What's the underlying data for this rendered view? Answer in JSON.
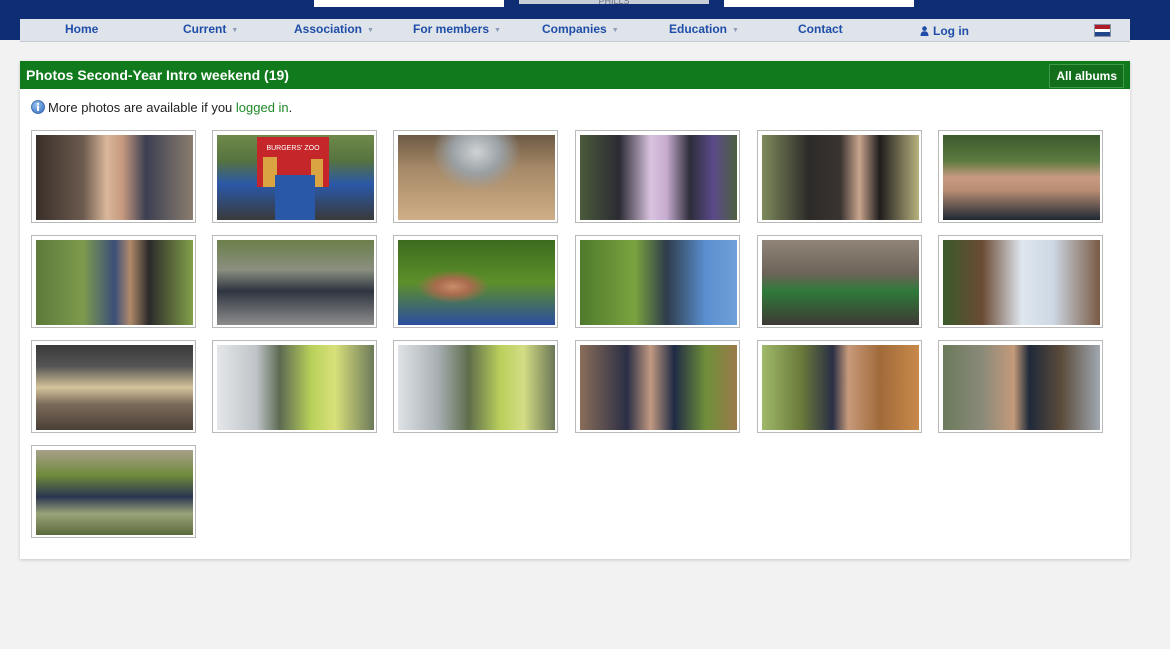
{
  "nav": {
    "items": [
      {
        "label": "Home",
        "caret": ""
      },
      {
        "label": "Current",
        "caret": "▼"
      },
      {
        "label": "Association",
        "caret": "▼"
      },
      {
        "label": "For members",
        "caret": "▼"
      },
      {
        "label": "Companies",
        "caret": "▼"
      },
      {
        "label": "Education",
        "caret": "▼"
      },
      {
        "label": "Contact",
        "caret": ""
      }
    ],
    "login_label": "Log in",
    "flag_icon": "dutch-flag-icon"
  },
  "banner": {
    "partner_text": "PHILLS"
  },
  "album": {
    "title": "Photos Second-Year Intro weekend (19)",
    "all_albums_label": "All albums"
  },
  "notice": {
    "prefix": "More photos are available if you ",
    "link": "logged in",
    "suffix": "."
  },
  "colors": {
    "header_green": "#117a1c",
    "link_blue": "#1f4ea8",
    "link_green": "#1e8a28",
    "top_navy": "#0e2d73"
  },
  "photos": [
    {
      "name": "photo-1",
      "icon": "photo-thumbnail"
    },
    {
      "name": "photo-2",
      "icon": "photo-thumbnail",
      "sign_text": "BURGERS' ZOO"
    },
    {
      "name": "photo-3",
      "icon": "photo-thumbnail"
    },
    {
      "name": "photo-4",
      "icon": "photo-thumbnail"
    },
    {
      "name": "photo-5",
      "icon": "photo-thumbnail"
    },
    {
      "name": "photo-6",
      "icon": "photo-thumbnail"
    },
    {
      "name": "photo-7",
      "icon": "photo-thumbnail"
    },
    {
      "name": "photo-8",
      "icon": "photo-thumbnail"
    },
    {
      "name": "photo-9",
      "icon": "photo-thumbnail"
    },
    {
      "name": "photo-10",
      "icon": "photo-thumbnail"
    },
    {
      "name": "photo-11",
      "icon": "photo-thumbnail"
    },
    {
      "name": "photo-12",
      "icon": "photo-thumbnail"
    },
    {
      "name": "photo-13",
      "icon": "photo-thumbnail"
    },
    {
      "name": "photo-14",
      "icon": "photo-thumbnail"
    },
    {
      "name": "photo-15",
      "icon": "photo-thumbnail"
    },
    {
      "name": "photo-16",
      "icon": "photo-thumbnail"
    },
    {
      "name": "photo-17",
      "icon": "photo-thumbnail"
    },
    {
      "name": "photo-18",
      "icon": "photo-thumbnail"
    },
    {
      "name": "photo-19",
      "icon": "photo-thumbnail"
    }
  ]
}
